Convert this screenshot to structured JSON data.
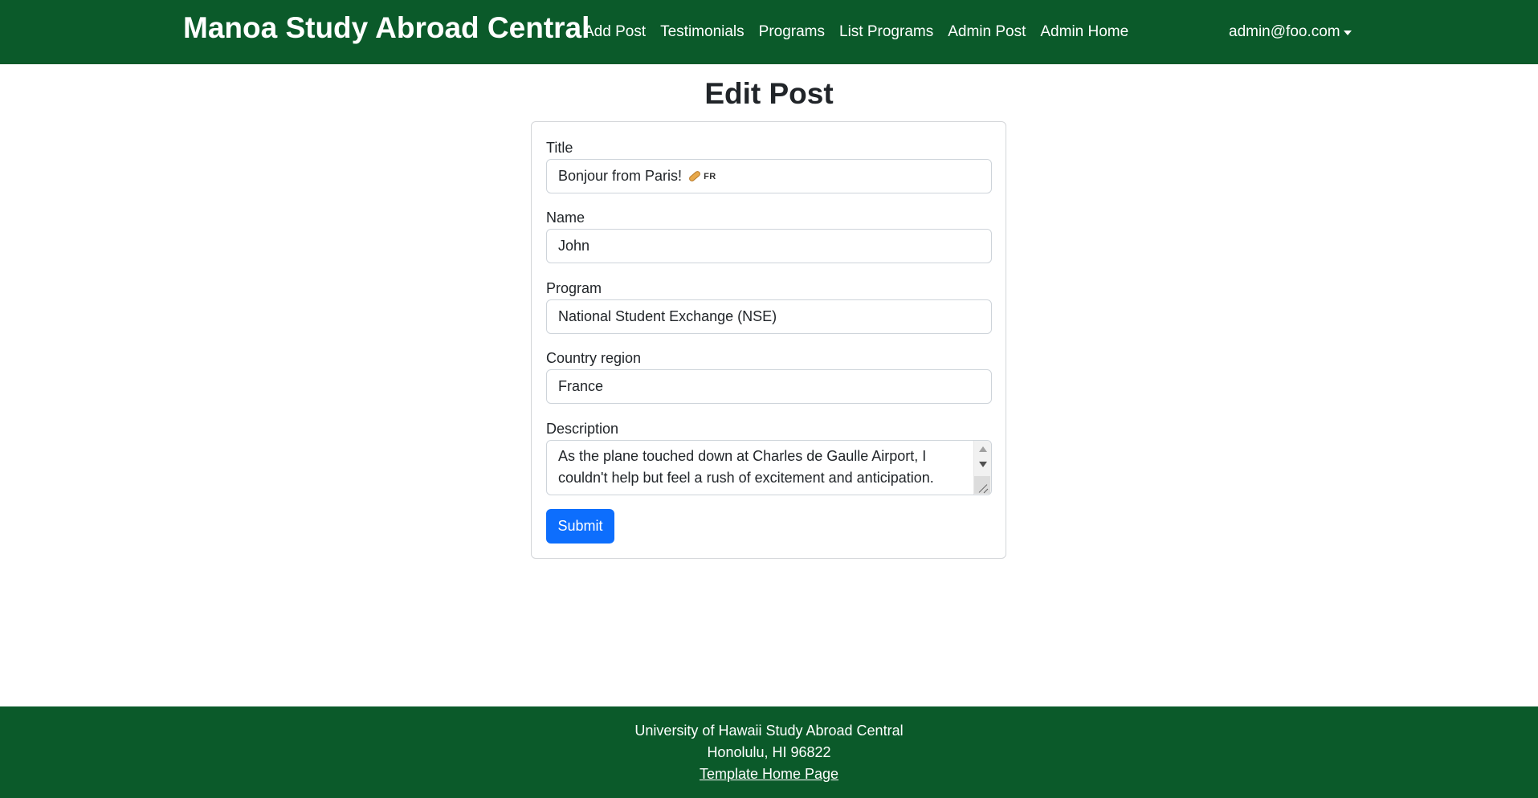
{
  "navbar": {
    "brand": "Manoa Study Abroad Central",
    "links": [
      "Add Post",
      "Testimonials",
      "Programs",
      "List Programs",
      "Admin Post",
      "Admin Home"
    ],
    "user": "admin@foo.com",
    "background_color": "#0b5a2a"
  },
  "page": {
    "title": "Edit Post"
  },
  "form": {
    "title_label": "Title",
    "title_value": "Bonjour from Paris!",
    "title_flag_text": "FR",
    "name_label": "Name",
    "name_value": "John",
    "program_label": "Program",
    "program_value": "National Student Exchange (NSE)",
    "country_label": "Country region",
    "country_value": "France",
    "description_label": "Description",
    "description_value": "As the plane touched down at Charles de Gaulle Airport, I couldn't help but feel a rush of excitement and anticipation.",
    "submit_label": "Submit",
    "submit_color": "#0d6efd"
  },
  "footer": {
    "line1": "University of Hawaii Study Abroad Central",
    "line2": "Honolulu, HI 96822",
    "link": "Template Home Page"
  }
}
